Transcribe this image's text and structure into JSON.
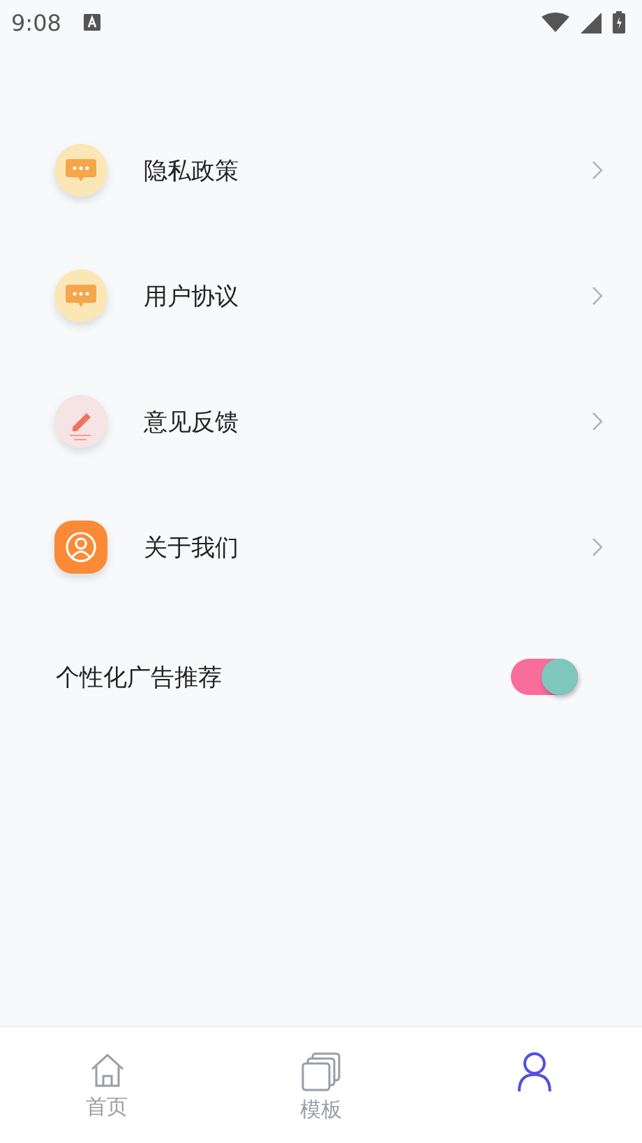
{
  "status_bar": {
    "time": "9:08"
  },
  "menu_items": [
    {
      "label": "隐私政策",
      "kind": "chat"
    },
    {
      "label": "用户协议",
      "kind": "chat"
    },
    {
      "label": "意见反馈",
      "kind": "pencil"
    },
    {
      "label": "关于我们",
      "kind": "person"
    }
  ],
  "ad_toggle": {
    "label": "个性化广告推荐",
    "on": true
  },
  "tab_bar": [
    {
      "label": "首页",
      "kind": "home",
      "selected": false
    },
    {
      "label": "模板",
      "kind": "templates",
      "selected": false
    },
    {
      "kind": "profile",
      "selected": true
    }
  ]
}
